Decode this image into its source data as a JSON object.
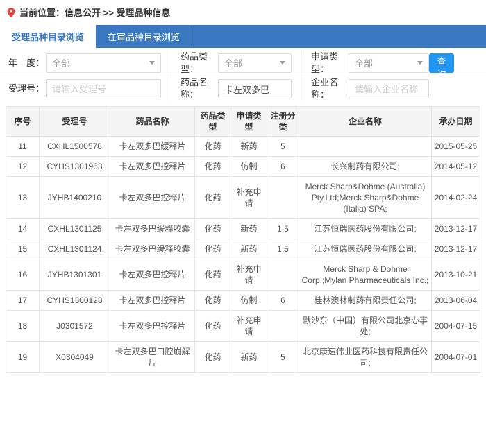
{
  "breadcrumb": {
    "label": "当前位置：信息公开 >> 受理品种信息"
  },
  "tabs": {
    "accepted": "受理品种目录浏览",
    "under_review": "在审品种目录浏览"
  },
  "filters": {
    "year_label": "年　度：",
    "year_value": "全部",
    "drug_type_label": "药品类型：",
    "drug_type_value": "全部",
    "apply_type_label": "申请类型：",
    "apply_type_value": "全部",
    "accept_no_label": "受理号：",
    "accept_no_placeholder": "请输入受理号",
    "drug_name_label": "药品名称：",
    "drug_name_value": "卡左双多巴",
    "company_label": "企业名称：",
    "company_placeholder": "请输入企业名称",
    "search_button": "查询"
  },
  "table": {
    "headers": [
      "序号",
      "受理号",
      "药品名称",
      "药品类型",
      "申请类型",
      "注册分类",
      "企业名称",
      "承办日期"
    ],
    "rows": [
      [
        "11",
        "CXHL1500578",
        "卡左双多巴缓释片",
        "化药",
        "新药",
        "5",
        "",
        "2015-05-25"
      ],
      [
        "12",
        "CYHS1301963",
        "卡左双多巴控释片",
        "化药",
        "仿制",
        "6",
        "长兴制药有限公司;",
        "2014-05-12"
      ],
      [
        "13",
        "JYHB1400210",
        "卡左双多巴控释片",
        "化药",
        "补充申请",
        "",
        "Merck Sharp&Dohme (Australia) Pty.Ltd;Merck Sharp&Dohme (Italia) SPA;",
        "2014-02-24"
      ],
      [
        "14",
        "CXHL1301125",
        "卡左双多巴缓释胶囊",
        "化药",
        "新药",
        "1.5",
        "江苏恒瑞医药股份有限公司;",
        "2013-12-17"
      ],
      [
        "15",
        "CXHL1301124",
        "卡左双多巴缓释胶囊",
        "化药",
        "新药",
        "1.5",
        "江苏恒瑞医药股份有限公司;",
        "2013-12-17"
      ],
      [
        "16",
        "JYHB1301301",
        "卡左双多巴控释片",
        "化药",
        "补充申请",
        "",
        "Merck Sharp & Dohme Corp.;Mylan Pharmaceuticals Inc.;",
        "2013-10-21"
      ],
      [
        "17",
        "CYHS1300128",
        "卡左双多巴控释片",
        "化药",
        "仿制",
        "6",
        "桂林澳林制药有限责任公司;",
        "2013-06-04"
      ],
      [
        "18",
        "J0301572",
        "卡左双多巴控释片",
        "化药",
        "补充申请",
        "",
        "默沙东（中国）有限公司北京办事处;",
        "2004-07-15"
      ],
      [
        "19",
        "X0304049",
        "卡左双多巴口腔崩解片",
        "化药",
        "新药",
        "5",
        "北京康速伟业医药科技有限责任公司;",
        "2004-07-01"
      ]
    ]
  },
  "colors": {
    "tab_bar": "#3a79c1",
    "search_button": "#2196f3",
    "pin_icon": "#e8433a"
  }
}
